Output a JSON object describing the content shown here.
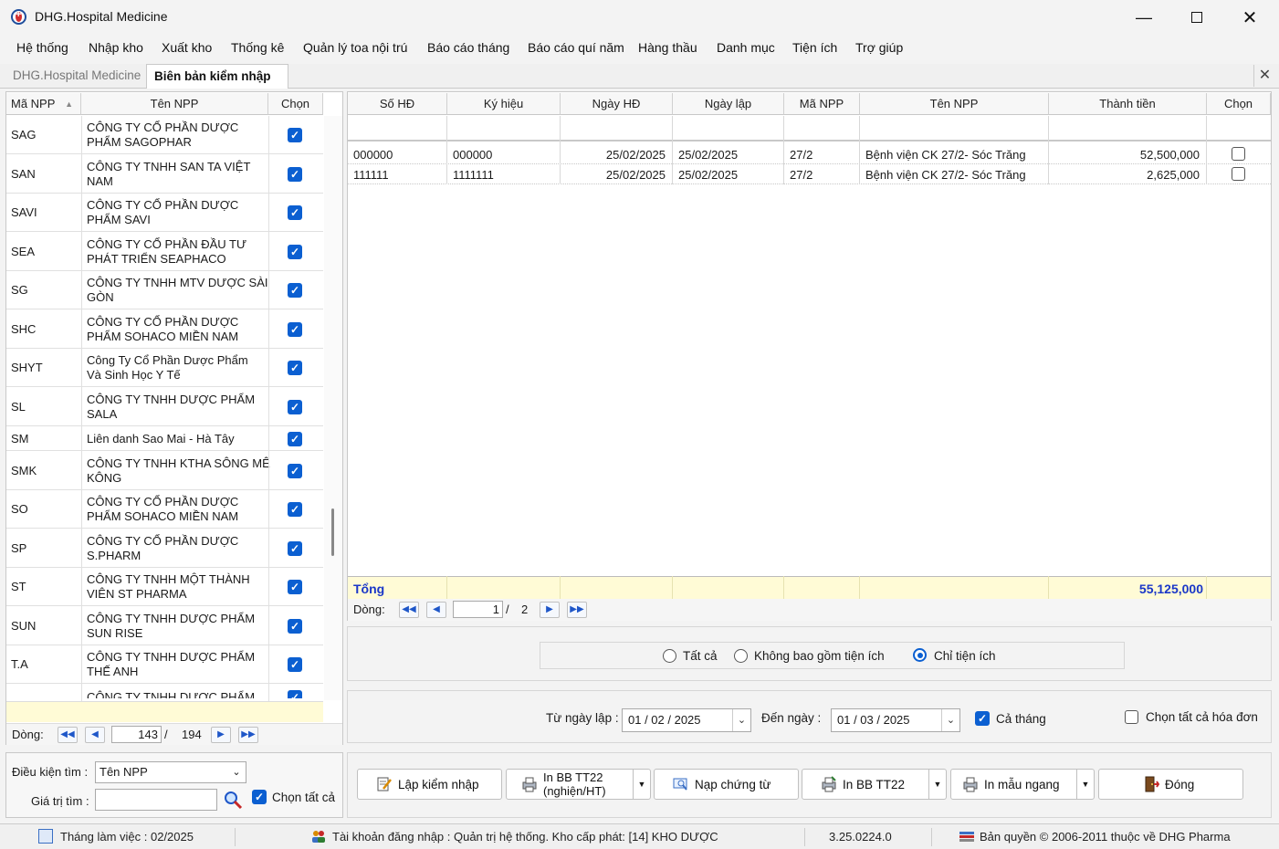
{
  "window": {
    "title": "DHG.Hospital Medicine"
  },
  "menu": [
    "Hệ thống",
    "Nhập kho",
    "Xuất kho",
    "Thống kê",
    "Quản lý toa nội trú",
    "Báo cáo tháng",
    "Báo cáo quí năm",
    "Hàng thầu",
    "Danh mục",
    "Tiện ích",
    "Trợ giúp"
  ],
  "tabs": {
    "inactive": "DHG.Hospital Medicine",
    "active": "Biên bản kiểm nhập"
  },
  "left_grid": {
    "headers": {
      "code": "Mã NPP",
      "name": "Tên NPP",
      "select": "Chọn"
    },
    "rows": [
      {
        "code": "SAG",
        "name1": "CÔNG TY CỔ PHẦN DƯỢC",
        "name2": "PHẨM SAGOPHAR",
        "checked": true
      },
      {
        "code": "SAN",
        "name1": "CÔNG TY TNHH SAN TA VIỆT",
        "name2": "NAM",
        "checked": true
      },
      {
        "code": "SAVI",
        "name1": "CÔNG TY CỔ PHẦN DƯỢC",
        "name2": "PHẨM SAVI",
        "checked": true
      },
      {
        "code": "SEA",
        "name1": "CÔNG TY CỔ PHẦN ĐẦU TƯ",
        "name2": "PHÁT TRIỂN SEAPHACO",
        "checked": true
      },
      {
        "code": "SG",
        "name1": "CÔNG TY TNHH MTV DƯỢC SÀI",
        "name2": "GÒN",
        "checked": true
      },
      {
        "code": "SHC",
        "name1": "CÔNG TY CỔ PHẦN DƯỢC",
        "name2": "PHẨM SOHACO MIỀN NAM",
        "checked": true
      },
      {
        "code": "SHYT",
        "name1": "Công Ty Cổ Phần Dược Phẩm",
        "name2": "Và Sinh Học Y Tế",
        "checked": true
      },
      {
        "code": "SL",
        "name1": "CÔNG TY TNHH DƯỢC PHẨM",
        "name2": "SALA",
        "checked": true
      },
      {
        "code": "SM",
        "name1": "Liên danh Sao Mai - Hà Tây",
        "name2": "",
        "checked": true
      },
      {
        "code": "SMK",
        "name1": "CÔNG TY TNHH KTHA SÔNG MÊ",
        "name2": "KÔNG",
        "checked": true
      },
      {
        "code": "SO",
        "name1": "CÔNG TY CỔ PHẦN DƯỢC",
        "name2": "PHẨM SOHACO MIỀN NAM",
        "checked": true
      },
      {
        "code": "SP",
        "name1": "CÔNG TY CỔ PHẦN DƯỢC",
        "name2": "S.PHARM",
        "checked": true
      },
      {
        "code": "ST",
        "name1": "CÔNG TY TNHH MỘT THÀNH",
        "name2": "VIÊN ST PHARMA",
        "checked": true
      },
      {
        "code": "SUN",
        "name1": "CÔNG TY TNHH DƯỢC PHẨM",
        "name2": "SUN RISE",
        "checked": true
      },
      {
        "code": "T.A",
        "name1": "CÔNG TY TNHH DƯỢC PHẨM",
        "name2": "THẾ ANH",
        "checked": true
      },
      {
        "code": "",
        "name1": "CÔNG TY TNHH DƯỢC PHẨM",
        "name2": "",
        "checked": true
      }
    ],
    "nav": {
      "label": "Dòng:",
      "current": "143",
      "total": "194"
    }
  },
  "search": {
    "condition_label": "Điều kiện tìm :",
    "condition_value": "Tên NPP",
    "value_label": "Giá trị tìm :",
    "value": "",
    "select_all_label": "Chọn tất cả",
    "select_all_checked": true
  },
  "invoice_grid": {
    "headers": [
      "Số HĐ",
      "Ký hiệu",
      "Ngày HĐ",
      "Ngày lập",
      "Mã NPP",
      "Tên NPP",
      "Thành tiền",
      "Chọn"
    ],
    "rows": [
      {
        "so_hd": "000000",
        "ky_hieu": "000000",
        "ngay_hd": "25/02/2025",
        "ngay_lap": "25/02/2025",
        "ma_npp": "27/2",
        "ten_npp": "Bệnh viện CK 27/2- Sóc Trăng",
        "thanh_tien": "52,500,000",
        "checked": false
      },
      {
        "so_hd": "111111",
        "ky_hieu": "1111111",
        "ngay_hd": "25/02/2025",
        "ngay_lap": "25/02/2025",
        "ma_npp": "27/2",
        "ten_npp": "Bệnh viện CK 27/2- Sóc Trăng",
        "thanh_tien": "2,625,000",
        "checked": false
      }
    ],
    "total_label": "Tổng",
    "total_value": "55,125,000",
    "nav": {
      "label": "Dòng:",
      "current": "1",
      "total": "2"
    }
  },
  "filter": {
    "options": [
      "Tất cả",
      "Không bao gồm tiện ích",
      "Chỉ tiện ích"
    ],
    "selected": "Chỉ tiện ích"
  },
  "dates": {
    "from_label": "Từ ngày lập :",
    "from_value": "01 / 02 / 2025",
    "to_label": "Đến ngày :",
    "to_value": "01 / 03 / 2025",
    "whole_month_label": "Cả tháng",
    "whole_month_checked": true,
    "select_all_invoices_label": "Chọn tất cả hóa đơn",
    "select_all_invoices_checked": false
  },
  "actions": {
    "create": "Lập kiểm nhập",
    "print_tt22_line1": "In BB TT22",
    "print_tt22_line2": "(nghiện/HT)",
    "load_docs": "Nạp chứng từ",
    "print_bb_tt22": "In BB TT22",
    "print_landscape": "In mẫu ngang",
    "close": "Đóng"
  },
  "status": {
    "month": "Tháng làm việc : 02/2025",
    "account": "Tài khoản đăng nhập : Quản trị hệ thống. Kho cấp phát: [14] KHO DƯỢC",
    "version": "3.25.0224.0",
    "copyright": "Bản quyền © 2006-2011 thuộc về DHG Pharma"
  },
  "colors": {
    "accent": "#0b5fd1",
    "total_row_bg": "#fffbd6",
    "total_text": "#1a37c8"
  }
}
